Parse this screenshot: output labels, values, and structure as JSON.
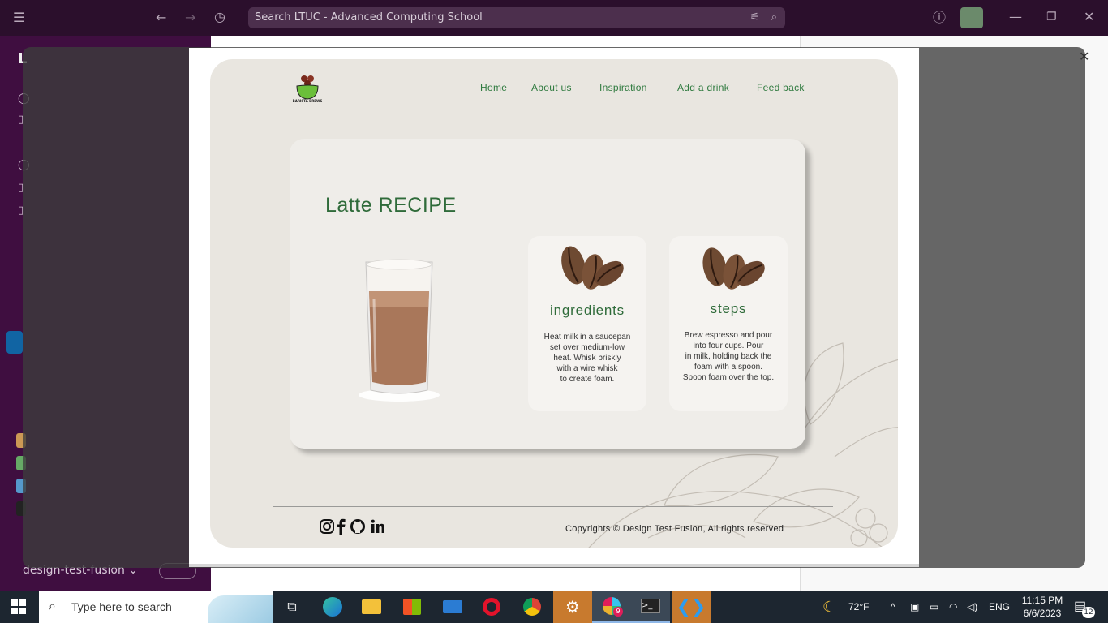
{
  "slack": {
    "search_placeholder": "Search LTUC - Advanced Computing School",
    "workspace": "design-test-fusion"
  },
  "site": {
    "nav": [
      "Home",
      "About us",
      "Inspiration",
      "Add a drink",
      "Feed back"
    ],
    "logo_text": "BARISTA BREWS",
    "recipe_title": "Latte RECIPE",
    "ingredients": {
      "title": "ingredients",
      "text": "Heat milk in a saucepan\nset over medium-low\nheat. Whisk briskly\nwith a wire whisk\nto create foam."
    },
    "steps": {
      "title": "steps",
      "text": "Brew espresso and pour\ninto four cups. Pour\nin milk, holding back the\nfoam with a spoon.\nSpoon foam over the top."
    },
    "social": [
      "instagram-icon",
      "facebook-icon",
      "github-icon",
      "linkedin-icon"
    ],
    "copyright": "Copyrights © Design Test Fusion, All rights reserved"
  },
  "taskbar": {
    "search_placeholder": "Type here to search",
    "weather": "72°F",
    "language": "ENG",
    "time": "11:15 PM",
    "date": "6/6/2023",
    "notifications": "12",
    "slack_badge": "9"
  },
  "colors": {
    "slack_topbar": "#2b0f2c",
    "slack_sidebar": "#3f0e40",
    "site_green": "#2f6b3a",
    "site_bg": "#e9e6e0"
  }
}
